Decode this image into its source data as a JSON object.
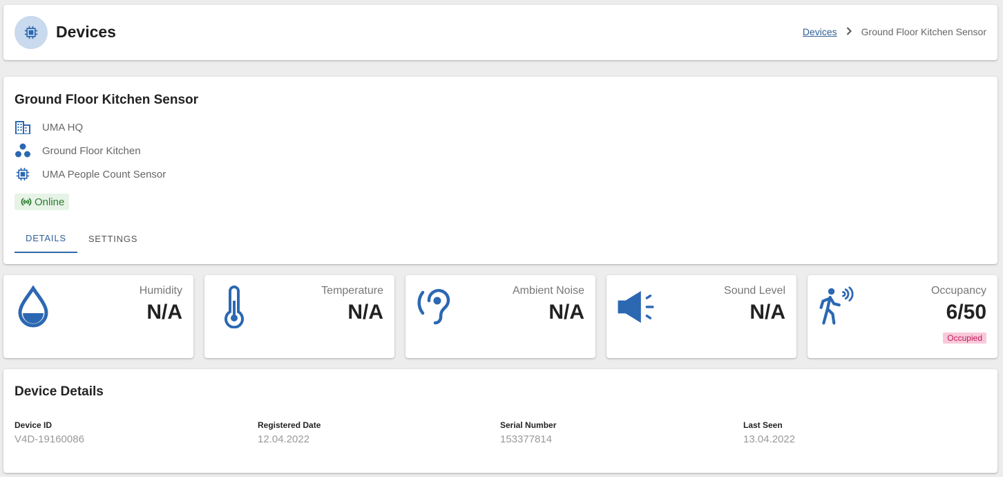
{
  "header": {
    "title": "Devices",
    "icon": "chip-icon",
    "breadcrumb": {
      "link": "Devices",
      "separator": "›",
      "current": "Ground Floor Kitchen Sensor"
    }
  },
  "device": {
    "name": "Ground Floor Kitchen Sensor",
    "building": "UMA HQ",
    "zone": "Ground Floor Kitchen",
    "type": "UMA People Count Sensor",
    "status": "Online"
  },
  "tabs": [
    {
      "label": "DETAILS",
      "active": true
    },
    {
      "label": "SETTINGS",
      "active": false
    }
  ],
  "metrics": {
    "humidity": {
      "label": "Humidity",
      "value": "N/A",
      "icon": "water-drop-icon"
    },
    "temperature": {
      "label": "Temperature",
      "value": "N/A",
      "icon": "thermometer-icon"
    },
    "ambient_noise": {
      "label": "Ambient Noise",
      "value": "N/A",
      "icon": "ear-icon"
    },
    "sound_level": {
      "label": "Sound Level",
      "value": "N/A",
      "icon": "speaker-icon"
    },
    "occupancy": {
      "label": "Occupancy",
      "value": "6/50",
      "badge": "Occupied",
      "icon": "person-walking-sensor-icon"
    }
  },
  "details": {
    "title": "Device Details",
    "fields": [
      {
        "label": "Device ID",
        "value": "V4D-19160086"
      },
      {
        "label": "Registered Date",
        "value": "12.04.2022"
      },
      {
        "label": "Serial Number",
        "value": "153377814"
      },
      {
        "label": "Last Seen",
        "value": "13.04.2022"
      }
    ]
  },
  "colors": {
    "accent": "#2f6aa9",
    "icon_blue": "#2c68b2",
    "online_text": "#2e7d32",
    "online_bg": "#e6f3e6",
    "occupied_bg": "#f8c9d9",
    "occupied_text": "#c2185b"
  }
}
